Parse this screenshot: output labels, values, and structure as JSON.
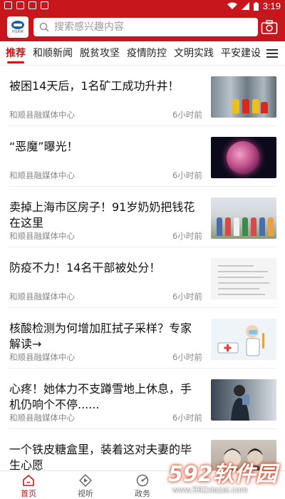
{
  "status_bar": {
    "time": "3:19"
  },
  "header": {
    "logo_text": "HSRM",
    "search_placeholder": "搜索感兴趣内容"
  },
  "tabs": [
    {
      "label": "推荐",
      "active": true
    },
    {
      "label": "和顺新闻",
      "active": false
    },
    {
      "label": "脱贫攻坚",
      "active": false
    },
    {
      "label": "疫情防控",
      "active": false
    },
    {
      "label": "文明实践",
      "active": false
    },
    {
      "label": "平安建设",
      "active": false
    }
  ],
  "feed": [
    {
      "title": "被困14天后，1名矿工成功升井！",
      "source": "和顺县融媒体中心",
      "time": "6小时前"
    },
    {
      "title": "“恶魔”曝光！",
      "source": "和顺县融媒体中心",
      "time": "6小时前"
    },
    {
      "title": "卖掉上海市区房子！91岁奶奶把钱花在这里",
      "source": "和顺县融媒体中心",
      "time": "6小时前"
    },
    {
      "title": "防疫不力！14名干部被处分！",
      "source": "和顺县融媒体中心",
      "time": "6小时前"
    },
    {
      "title": "核酸检测为何增加肛拭子采样？专家解读→",
      "source": "和顺县融媒体中心",
      "time": "6小时前"
    },
    {
      "title": "心疼！她体力不支蹲雪地上休息，手机仍响个不停......",
      "source": "和顺县融媒体中心",
      "time": "6小时前"
    },
    {
      "title": "一个铁皮糖盒里，装着这对夫妻的毕生心愿",
      "source": "",
      "time": ""
    }
  ],
  "bottom_nav": [
    {
      "label": "首页",
      "icon": "home-icon",
      "active": true
    },
    {
      "label": "视听",
      "icon": "play-icon",
      "active": false
    },
    {
      "label": "政务",
      "icon": "government-icon",
      "active": false
    }
  ],
  "watermark": {
    "main": "592软件园",
    "url": "www.592xiazai.com"
  },
  "colors": {
    "brand_red": "#c8161d"
  }
}
